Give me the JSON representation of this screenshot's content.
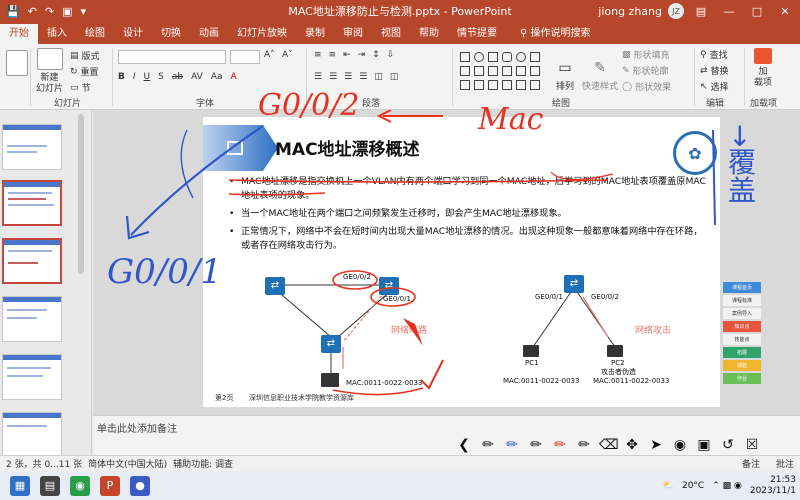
{
  "window": {
    "title": "MAC地址漂移防止与检测.pptx  -  PowerPoint",
    "user": "jiong zhang",
    "avatar_initials": "JZ",
    "controls": [
      "—",
      "□",
      "✕"
    ]
  },
  "ribbon_tabs": [
    "开始",
    "插入",
    "绘图",
    "设计",
    "切换",
    "动画",
    "幻灯片放映",
    "录制",
    "审阅",
    "视图",
    "帮助",
    "情节提要"
  ],
  "tell_me": "操作说明搜索",
  "ribbon": {
    "groups": {
      "slides": "幻灯片",
      "font": "字体",
      "paragraph": "段落",
      "drawing": "绘图",
      "editing": "编辑",
      "addins": "加载项"
    },
    "buttons": {
      "new_slide": "新建\n幻灯片",
      "layout": "版式",
      "reset": "重置",
      "section": "节",
      "arrange": "排列",
      "quick_styles": "快速样式",
      "shape_fill": "形状填充",
      "shape_outline": "形状轮廓",
      "shape_effects": "形状效果",
      "find": "查找",
      "replace": "替换",
      "select": "选择",
      "addins": "加\n载项"
    }
  },
  "slide": {
    "title": "MAC地址漂移概述",
    "bullets": [
      "MAC地址漂移是指交换机上一个VLAN内有两个端口学习到同一个MAC地址，后学习到的MAC地址表项覆盖原MAC地址表项的现象。",
      "当一个MAC地址在两个端口之间频繁发生迁移时，即会产生MAC地址漂移现象。",
      "正常情况下，网络中不会在短时间内出现大量MAC地址漂移的情况。出现这种现象一般都意味着网络中存在环路，或者存在网络攻击行为。"
    ],
    "diagram_left": {
      "port1": "GE0/0/2",
      "port2": "GE0/0/1",
      "pc_mac": "MAC:0011-0022-0033",
      "label": "网络环路"
    },
    "diagram_right": {
      "port1": "GE0/0/1",
      "port2": "GE0/0/2",
      "pc1": "PC1",
      "pc2": "PC2",
      "pc2_note": "攻击者伪造",
      "pc1_mac": "MAC:0011-0022-0033",
      "pc2_mac": "MAC:0011-0022-0033",
      "label": "网络攻击"
    },
    "footer_page": "第2页",
    "footer_school": "深圳信息职业技术学院教学资源库",
    "annotations": {
      "top_port": "G0/0/2",
      "mac_word": "Mac",
      "left_port": "G0/0/1",
      "side_note": "→覆盖"
    }
  },
  "side_tags": [
    "课程首页",
    "课程标准",
    "案例导入",
    "知识点",
    "技能点",
    "拓展",
    "测验",
    "作业"
  ],
  "notes_placeholder": "单击此处添加备注",
  "status": {
    "slide_count": "2 张，共 0...11 张",
    "language": "简体中文(中国大陆)",
    "accessibility": "辅助功能: 调查",
    "notes": "备注",
    "comments": "批注"
  },
  "taskbar": {
    "weather": "20°C",
    "time": "21:53",
    "date": "2023/11/1"
  },
  "colors": {
    "accent": "#b7472a",
    "ink_red": "#e53322",
    "ink_blue": "#2f57c8"
  }
}
